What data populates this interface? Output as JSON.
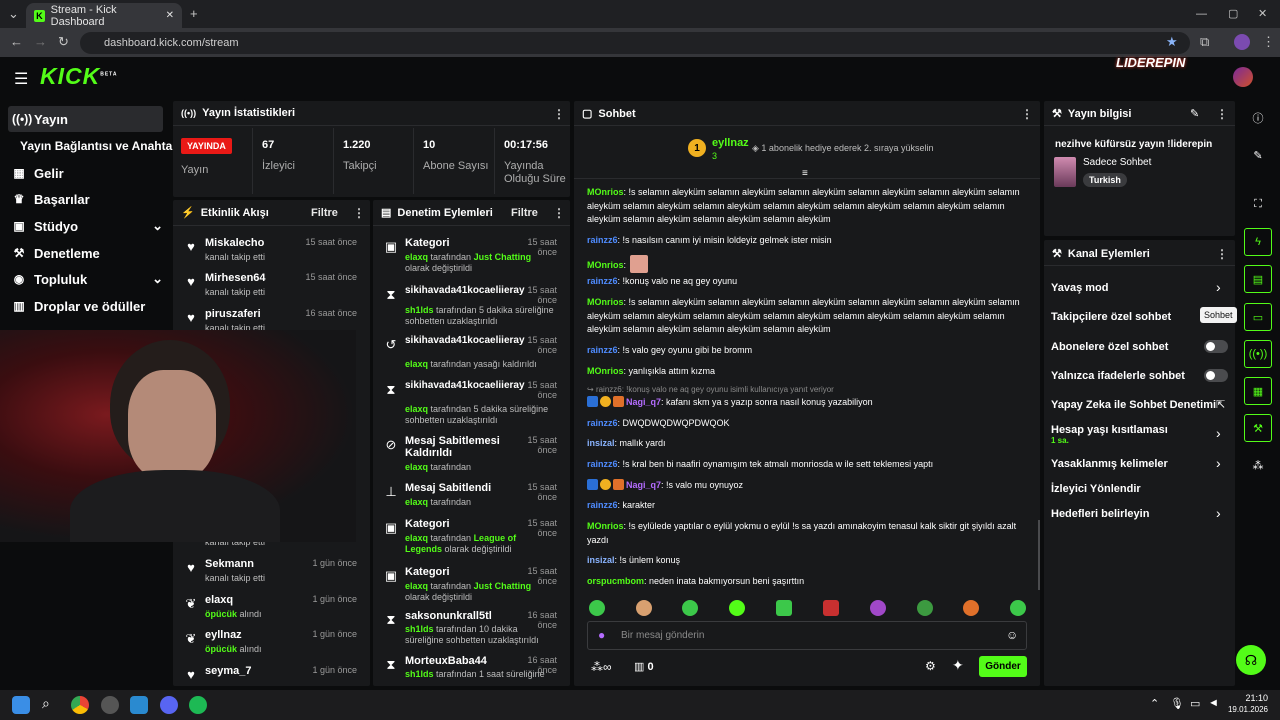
{
  "browser": {
    "tab_title": "Stream - Kick Dashboard",
    "url": "dashboard.kick.com/stream"
  },
  "header": {
    "logo": "KICK",
    "logo_sup": "BETA",
    "brand_overlay": "LIDEREPIN"
  },
  "sidebar": {
    "items": [
      {
        "label": "Yayın",
        "icon": "live-broadcast-icon"
      },
      {
        "label": "Yayın Bağlantısı ve Anahtarı",
        "icon": ""
      },
      {
        "label": "Gelir",
        "icon": "revenue-icon"
      },
      {
        "label": "Başarılar",
        "icon": "trophy-icon"
      },
      {
        "label": "Stüdyo",
        "icon": "studio-icon"
      },
      {
        "label": "Denetleme",
        "icon": "wrench-icon"
      },
      {
        "label": "Topluluk",
        "icon": "community-icon"
      },
      {
        "label": "Droplar ve ödüller",
        "icon": "gift-icon"
      }
    ]
  },
  "stats": {
    "title": "Yayın İstatistikleri",
    "live_badge": "YAYINDA",
    "status_label": "Yayın",
    "viewers": "67",
    "viewers_label": "İzleyici",
    "followers": "1.220",
    "followers_label": "Takipçi",
    "subs": "10",
    "subs_label": "Abone Sayısı",
    "duration": "00:17:56",
    "duration_label": "Yayında Olduğu Süre"
  },
  "activity": {
    "title": "Etkinlik Akışı",
    "filter": "Filtre",
    "items": [
      {
        "name": "Miskalecho",
        "sub": "kanalı takip etti",
        "time": "15 saat önce"
      },
      {
        "name": "Mirhesen64",
        "sub": "kanalı takip etti",
        "time": "15 saat önce"
      },
      {
        "name": "piruszaferi",
        "sub": "kanalı takip etti",
        "time": "16 saat önce"
      },
      {
        "name": "Sekmann",
        "sub": "kanalı takip etti",
        "time": "1 gün önce"
      },
      {
        "name": "elaxq",
        "sub_g": "öpücük",
        "sub": " alındı",
        "time": "1 gün önce"
      },
      {
        "name": "eyllnaz",
        "sub_g": "öpücük",
        "sub": " alındı",
        "time": "1 gün önce"
      },
      {
        "name": "seyma_7",
        "sub": "",
        "time": "1 gün önce"
      }
    ],
    "partial_sub": "kanalı takip etti"
  },
  "moderation": {
    "title": "Denetim Eylemleri",
    "filter": "Filtre",
    "items": [
      {
        "name": "Kategori",
        "actor": "elaxq",
        "pre": " tarafından ",
        "hl": "Just Chatting",
        "post": " olarak değiştirildi",
        "time": "15 saat önce"
      },
      {
        "name": "sikihavada41kocaeliieray",
        "actor": "sh1lds",
        "pre": " tarafından 5 dakika süreliğine sohbetten uzaklaştırıldı",
        "hl": "",
        "post": "",
        "time": "15 saat önce"
      },
      {
        "name": "sikihavada41kocaeliieray",
        "actor": "elaxq",
        "pre": " tarafından yasağı kaldırıldı",
        "hl": "",
        "post": "",
        "time": "15 saat önce"
      },
      {
        "name": "sikihavada41kocaeliieray",
        "actor": "elaxq",
        "pre": " tarafından 5 dakika süreliğine sohbetten uzaklaştırıldı",
        "hl": "",
        "post": "",
        "time": "15 saat önce"
      },
      {
        "name": "Mesaj Sabitlemesi Kaldırıldı",
        "actor": "elaxq",
        "pre": " tarafından",
        "hl": "",
        "post": "",
        "time": "15 saat önce"
      },
      {
        "name": "Mesaj Sabitlendi",
        "actor": "elaxq",
        "pre": " tarafından",
        "hl": "",
        "post": "",
        "time": "15 saat önce"
      },
      {
        "name": "Kategori",
        "actor": "elaxq",
        "pre": " tarafından ",
        "hl": "League of Legends",
        "post": " olarak değiştirildi",
        "time": "15 saat önce"
      },
      {
        "name": "Kategori",
        "actor": "elaxq",
        "pre": " tarafından ",
        "hl": "Just Chatting",
        "post": " olarak değiştirildi",
        "time": "15 saat önce"
      },
      {
        "name": "saksonunkrall5tl",
        "actor": "sh1lds",
        "pre": " tarafından 10 dakika süreliğine sohbetten uzaklaştırıldı",
        "hl": "",
        "post": "",
        "time": "16 saat önce"
      },
      {
        "name": "MorteuxBaba44",
        "actor": "sh1lds",
        "pre": " tarafından 1 saat süreliğine",
        "hl": "",
        "post": "",
        "time": "16 saat önce"
      }
    ]
  },
  "chat": {
    "title": "Sohbet",
    "pinned_rank": "1",
    "pinned_user": "eyllnaz",
    "pinned_count": "3",
    "pinned_text": "1 abonelik hediye ederek 2. sıraya yükselin",
    "reply_ref": "rainzz6: !konuş valo ne aq gey oyunu isimli kullanıcıya yanıt veriyor",
    "placeholder": "Bir mesaj gönderin",
    "points": "0",
    "send": "Gönder",
    "messages": [
      {
        "user": "MOnrios",
        "cls": "uc",
        "text": ": !s selamın aleyküm selamın aleyküm selamın aleyküm selamın aleyküm selamın aleyküm selamın aleyküm selamın aleyküm selamın aleyküm selamın aleyküm selamın aleyküm selamın aleyküm selamın aleyküm selamın aleyküm selamın aleyküm selamın aleyküm"
      },
      {
        "user": "rainzz6",
        "cls": "ub",
        "text": ": !s nasılsın canım iyi misin loldeyiz gelmek ister misin"
      },
      {
        "user": "MOnrios",
        "cls": "uc",
        "text": ":"
      },
      {
        "user": "rainzz6",
        "cls": "ub",
        "text": ": !konuş valo ne aq gey oyunu"
      },
      {
        "user": "MOnrios",
        "cls": "uc",
        "text": ": !s selamın aleyküm selamın aleyküm selamın aleyküm selamın aleyküm selamın aleyküm selamın aleyküm selamın aleyküm selamın aleyküm selamın aleyküm selamın aleyküm selamın aleyküm selamın aleyküm selamın aleyküm selamın aleyküm selamın aleyküm"
      },
      {
        "user": "rainzz6",
        "cls": "ub",
        "text": ": !s valo gey oyunu gibi be bromm"
      },
      {
        "user": "MOnrios",
        "cls": "uc",
        "text": ": yanlışıkla attım kızma"
      },
      {
        "user": "Nagi_q7",
        "cls": "up",
        "text": ": kafanı skm ya s yazıp sonra nasıl konuş yazabiliyon"
      },
      {
        "user": "rainzz6",
        "cls": "ub",
        "text": ": DWQDWQDWQPDWQOK"
      },
      {
        "user": "insizal",
        "cls": "ul",
        "text": ": mallık yardı"
      },
      {
        "user": "rainzz6",
        "cls": "ub",
        "text": ": !s kral ben bi naafiri oynamışım tek atmalı monriosda w ile sett teklemesi yaptı"
      },
      {
        "user": "Nagi_q7",
        "cls": "up",
        "text": ": !s valo mu oynuyoz"
      },
      {
        "user": "rainzz6",
        "cls": "ub",
        "text": ": karakter"
      },
      {
        "user": "MOnrios",
        "cls": "uc",
        "text": ": !s eylülede yaptılar o eylül yokmu o eylül !s sa yazdı amınakoyim tenasul kalk siktir git şiyıldı azalt yazdı"
      },
      {
        "user": "insizal",
        "cls": "ul",
        "text": ": !s ünlem konuş"
      },
      {
        "user": "orspucmbom",
        "cls": "uc",
        "text": ": neden inata bakmıyorsun beni şaşırttın"
      }
    ]
  },
  "stream_info": {
    "title": "Yayın bilgisi",
    "stream_title": "nezihve küfürsüz yayın !liderepin",
    "category": "Sadece Sohbet",
    "language": "Turkish"
  },
  "channel_actions": {
    "title": "Kanal Eylemleri",
    "items": [
      {
        "label": "Yavaş mod",
        "kind": "chevron"
      },
      {
        "label": "Takipçilere özel sohbet",
        "kind": "tooltip"
      },
      {
        "label": "Abonelere özel sohbet",
        "kind": "toggle"
      },
      {
        "label": "Yalnızca ifadelerle sohbet",
        "kind": "toggle"
      },
      {
        "label": "Yapay Zeka ile Sohbet Denetimi",
        "kind": "external"
      },
      {
        "label": "Hesap yaşı kısıtlaması",
        "kind": "chevron",
        "sub": "1 sa."
      },
      {
        "label": "Yasaklanmış kelimeler",
        "kind": "chevron"
      },
      {
        "label": "İzleyici Yönlendir",
        "kind": "none"
      },
      {
        "label": "Hedefleri belirleyin",
        "kind": "chevron"
      }
    ],
    "tooltip": "Sohbet"
  },
  "taskbar": {
    "time": "21:10",
    "date": "19.01.2026"
  },
  "colors": {
    "accent": "#53fc18",
    "panel": "#18191b",
    "live": "#e91916"
  }
}
